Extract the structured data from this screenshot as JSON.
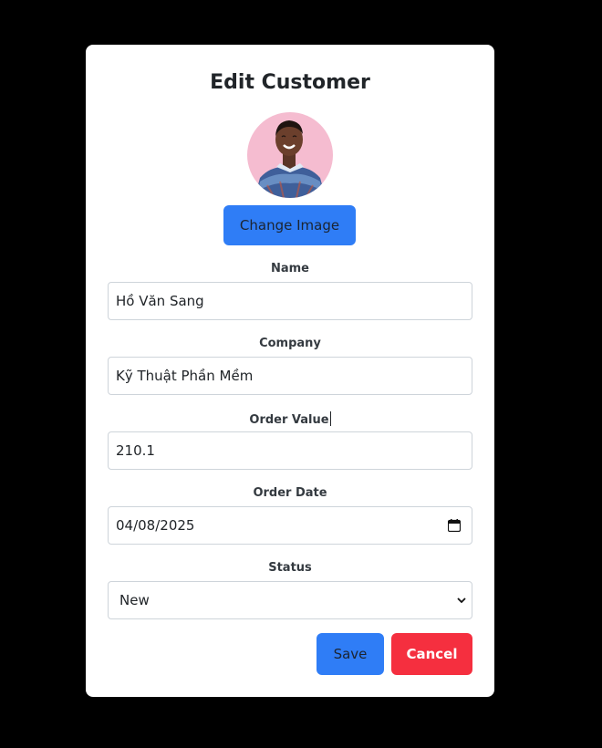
{
  "dialog": {
    "title": "Edit Customer",
    "change_image_label": "Change Image",
    "avatar_icon": "customer-avatar-photo"
  },
  "form": {
    "name": {
      "label": "Name",
      "value": "Hồ Văn Sang"
    },
    "company": {
      "label": "Company",
      "value": "Kỹ Thuật Phần Mềm"
    },
    "order_value": {
      "label": "Order Value",
      "value": "210.1"
    },
    "order_date": {
      "label": "Order Date",
      "value": "04/08/2025"
    },
    "status": {
      "label": "Status",
      "value": "New"
    }
  },
  "actions": {
    "save_label": "Save",
    "cancel_label": "Cancel"
  },
  "colors": {
    "primary": "#2f7df6",
    "danger": "#f52f3f",
    "backdrop": "#000000"
  }
}
